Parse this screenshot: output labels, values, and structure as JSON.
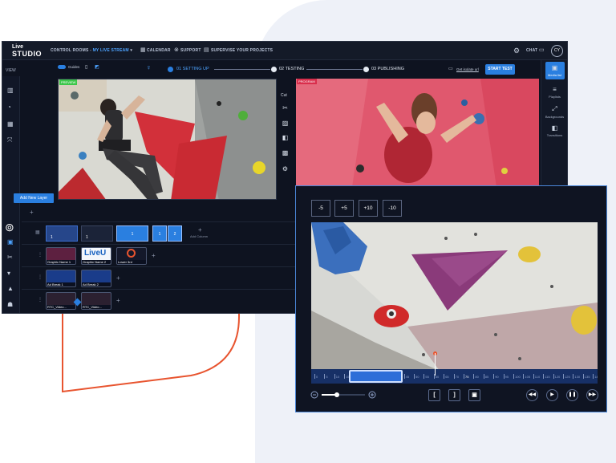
{
  "app": {
    "logo_top": "Live",
    "logo_bottom": "STUDIO"
  },
  "topnav": {
    "control_rooms": "CONTROL ROOMS -",
    "stream_name": "MY LIVE STREAM",
    "calendar": "CALENDAR",
    "support": "SUPPORT",
    "supervise": "SUPERVISE YOUR PROJECTS",
    "chat": "CHAT",
    "avatar_initials": "CY"
  },
  "viewbar": {
    "view_label": "VIEW",
    "guides_label": "Guides",
    "steps": [
      {
        "num": "01",
        "label": "SETTING UP"
      },
      {
        "num": "02",
        "label": "TESTING"
      },
      {
        "num": "03",
        "label": "PUBLISHING"
      }
    ],
    "isolate_link": "Get isolate url",
    "start_test": "START TEST"
  },
  "preview": {
    "tag": "PREVIEW"
  },
  "program": {
    "tag": "PROGRAM"
  },
  "tools": {
    "cut_label": "Cut"
  },
  "right_rail": [
    {
      "label": "Media list",
      "icon": "media-icon"
    },
    {
      "label": "Playlists",
      "icon": "playlist-icon"
    },
    {
      "label": "Backgrounds",
      "icon": "background-icon"
    },
    {
      "label": "Transitions",
      "icon": "transition-icon"
    }
  ],
  "layers": {
    "add_new_layer": "Add New Layer",
    "add_column": "Add Column",
    "column_numbers": [
      "1",
      "1",
      "1",
      "1",
      "2"
    ],
    "row1": [
      "Graphic Name 1",
      "Graphic Name 2",
      "Lower 3rd"
    ],
    "row2": [
      "Ad Break 1",
      "Ad Break 2"
    ],
    "row3": [
      "RTC_Video...",
      "RTC_Video..."
    ],
    "row2_thumb_text": "LiveU"
  },
  "editor": {
    "skip_buttons": [
      "-5",
      "+5",
      "+10",
      "-10"
    ],
    "timeline_labels": [
      "0",
      "5",
      "10",
      "15",
      "20",
      "25",
      "30",
      "35",
      "40",
      "45",
      "50",
      "55",
      "60",
      "65",
      "70",
      "75",
      "80",
      "85",
      "90",
      "95",
      "100",
      "105",
      "110",
      "115",
      "120",
      "125",
      "130",
      "135",
      "140"
    ],
    "playhead_label": "75",
    "zoom_level": 0.35
  },
  "colors": {
    "accent": "#2a7fe0",
    "program_red": "#d92e4c",
    "preview_green": "#3cc64a",
    "brand_orange": "#e8542f"
  }
}
